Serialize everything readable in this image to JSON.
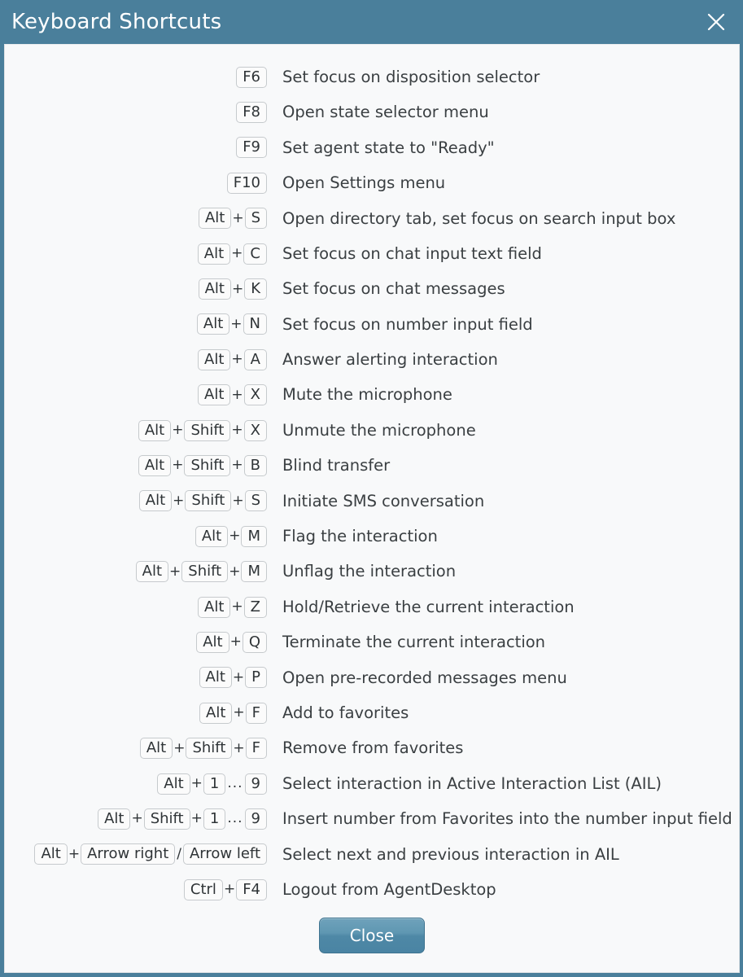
{
  "dialog": {
    "title": "Keyboard Shortcuts",
    "close_icon": "close-icon",
    "header_color": "#4a7f9b",
    "body_color": "#f8f9fa"
  },
  "shortcuts": [
    {
      "keys": [
        {
          "type": "key",
          "text": "F6"
        }
      ],
      "description": "Set focus on disposition selector"
    },
    {
      "keys": [
        {
          "type": "key",
          "text": "F8"
        }
      ],
      "description": "Open state selector menu"
    },
    {
      "keys": [
        {
          "type": "key",
          "text": "F9"
        }
      ],
      "description": "Set agent state to \"Ready\""
    },
    {
      "keys": [
        {
          "type": "key",
          "text": "F10"
        }
      ],
      "description": "Open Settings menu"
    },
    {
      "keys": [
        {
          "type": "key",
          "text": "Alt"
        },
        {
          "type": "sep",
          "text": "+"
        },
        {
          "type": "key",
          "text": "S"
        }
      ],
      "description": "Open directory tab, set focus on search input box"
    },
    {
      "keys": [
        {
          "type": "key",
          "text": "Alt"
        },
        {
          "type": "sep",
          "text": "+"
        },
        {
          "type": "key",
          "text": "C"
        }
      ],
      "description": "Set focus on chat input text field"
    },
    {
      "keys": [
        {
          "type": "key",
          "text": "Alt"
        },
        {
          "type": "sep",
          "text": "+"
        },
        {
          "type": "key",
          "text": "K"
        }
      ],
      "description": "Set focus on chat messages"
    },
    {
      "keys": [
        {
          "type": "key",
          "text": "Alt"
        },
        {
          "type": "sep",
          "text": "+"
        },
        {
          "type": "key",
          "text": "N"
        }
      ],
      "description": "Set focus on number input field"
    },
    {
      "keys": [
        {
          "type": "key",
          "text": "Alt"
        },
        {
          "type": "sep",
          "text": "+"
        },
        {
          "type": "key",
          "text": "A"
        }
      ],
      "description": "Answer alerting interaction"
    },
    {
      "keys": [
        {
          "type": "key",
          "text": "Alt"
        },
        {
          "type": "sep",
          "text": "+"
        },
        {
          "type": "key",
          "text": "X"
        }
      ],
      "description": "Mute the microphone"
    },
    {
      "keys": [
        {
          "type": "key",
          "text": "Alt"
        },
        {
          "type": "sep",
          "text": "+"
        },
        {
          "type": "key",
          "text": "Shift"
        },
        {
          "type": "sep",
          "text": "+"
        },
        {
          "type": "key",
          "text": "X"
        }
      ],
      "description": "Unmute the microphone"
    },
    {
      "keys": [
        {
          "type": "key",
          "text": "Alt"
        },
        {
          "type": "sep",
          "text": "+"
        },
        {
          "type": "key",
          "text": "Shift"
        },
        {
          "type": "sep",
          "text": "+"
        },
        {
          "type": "key",
          "text": "B"
        }
      ],
      "description": "Blind transfer"
    },
    {
      "keys": [
        {
          "type": "key",
          "text": "Alt"
        },
        {
          "type": "sep",
          "text": "+"
        },
        {
          "type": "key",
          "text": "Shift"
        },
        {
          "type": "sep",
          "text": "+"
        },
        {
          "type": "key",
          "text": "S"
        }
      ],
      "description": "Initiate SMS conversation"
    },
    {
      "keys": [
        {
          "type": "key",
          "text": "Alt"
        },
        {
          "type": "sep",
          "text": "+"
        },
        {
          "type": "key",
          "text": "M"
        }
      ],
      "description": "Flag the interaction"
    },
    {
      "keys": [
        {
          "type": "key",
          "text": "Alt"
        },
        {
          "type": "sep",
          "text": "+"
        },
        {
          "type": "key",
          "text": "Shift"
        },
        {
          "type": "sep",
          "text": "+"
        },
        {
          "type": "key",
          "text": "M"
        }
      ],
      "description": "Unflag the interaction"
    },
    {
      "keys": [
        {
          "type": "key",
          "text": "Alt"
        },
        {
          "type": "sep",
          "text": "+"
        },
        {
          "type": "key",
          "text": "Z"
        }
      ],
      "description": "Hold/Retrieve the current interaction"
    },
    {
      "keys": [
        {
          "type": "key",
          "text": "Alt"
        },
        {
          "type": "sep",
          "text": "+"
        },
        {
          "type": "key",
          "text": "Q"
        }
      ],
      "description": "Terminate the current interaction"
    },
    {
      "keys": [
        {
          "type": "key",
          "text": "Alt"
        },
        {
          "type": "sep",
          "text": "+"
        },
        {
          "type": "key",
          "text": "P"
        }
      ],
      "description": "Open pre-recorded messages menu"
    },
    {
      "keys": [
        {
          "type": "key",
          "text": "Alt"
        },
        {
          "type": "sep",
          "text": "+"
        },
        {
          "type": "key",
          "text": "F"
        }
      ],
      "description": "Add to favorites"
    },
    {
      "keys": [
        {
          "type": "key",
          "text": "Alt"
        },
        {
          "type": "sep",
          "text": "+"
        },
        {
          "type": "key",
          "text": "Shift"
        },
        {
          "type": "sep",
          "text": "+"
        },
        {
          "type": "key",
          "text": "F"
        }
      ],
      "description": "Remove from favorites"
    },
    {
      "keys": [
        {
          "type": "key",
          "text": "Alt"
        },
        {
          "type": "sep",
          "text": "+"
        },
        {
          "type": "key",
          "text": "1"
        },
        {
          "type": "ellipsis",
          "text": "..."
        },
        {
          "type": "key",
          "text": "9"
        }
      ],
      "description": "Select interaction in Active Interaction List (AIL)"
    },
    {
      "keys": [
        {
          "type": "key",
          "text": "Alt"
        },
        {
          "type": "sep",
          "text": "+"
        },
        {
          "type": "key",
          "text": "Shift"
        },
        {
          "type": "sep",
          "text": "+"
        },
        {
          "type": "key",
          "text": "1"
        },
        {
          "type": "ellipsis",
          "text": "..."
        },
        {
          "type": "key",
          "text": "9"
        }
      ],
      "description": "Insert number from Favorites into the number input field"
    },
    {
      "keys": [
        {
          "type": "key",
          "text": "Alt"
        },
        {
          "type": "sep",
          "text": "+"
        },
        {
          "type": "key",
          "text": "Arrow right"
        },
        {
          "type": "slash",
          "text": "/"
        },
        {
          "type": "key",
          "text": "Arrow left"
        }
      ],
      "description": "Select next and previous interaction in AIL"
    },
    {
      "keys": [
        {
          "type": "key",
          "text": "Ctrl"
        },
        {
          "type": "sep",
          "text": "+"
        },
        {
          "type": "key",
          "text": "F4"
        }
      ],
      "description": "Logout from AgentDesktop"
    }
  ],
  "footer": {
    "close_label": "Close"
  }
}
